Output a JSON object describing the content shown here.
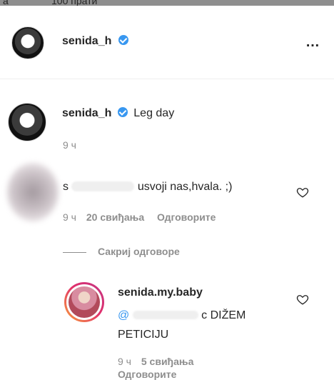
{
  "top_strip": {
    "left_text": "а",
    "count_text": "100 прати"
  },
  "header": {
    "username": "senida_h",
    "more_icon": "…",
    "icons": [
      "verified-badge-icon",
      "more-options-icon"
    ]
  },
  "caption": {
    "username": "senida_h",
    "text": "Leg day",
    "time": "9 ч"
  },
  "comment": {
    "text_start": "s",
    "text_end": "usvoji nas,hvala. ;)",
    "time": "9 ч",
    "likes": "20 свиђања",
    "reply_label": "Одговорите",
    "hide_replies": "Сакриј одговоре"
  },
  "reply": {
    "username": "senida.my.baby",
    "text_start": "@",
    "text_end": "c DIŽEM",
    "text_line2": "PETICIJU",
    "time": "9 ч",
    "likes": "5 свиђања",
    "reply_label": "Одговорите"
  },
  "colors": {
    "verified": "#3897f0",
    "meta": "#8e8e8e",
    "text": "#262626"
  }
}
